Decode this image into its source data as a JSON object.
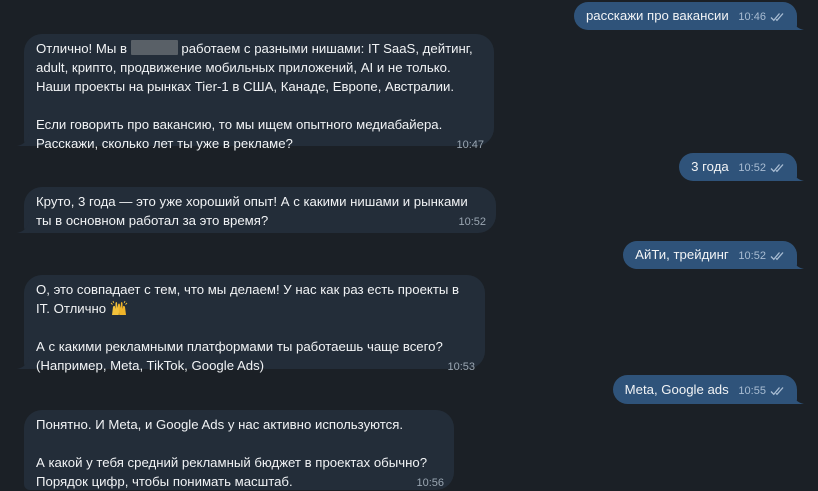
{
  "messages": {
    "m1": {
      "text": "расскажи про вакансии",
      "time": "10:46",
      "read": true
    },
    "m2": {
      "line1_before": "Отлично! Мы в",
      "line1_after": "работаем с разными нишами: IT SaaS, дейтинг,",
      "line2": "adult, крипто, продвижение мобильных приложений, AI и не только.",
      "line3": "Наши проекты на рынках Tier-1 в США, Канаде, Европе, Австралии.",
      "line4": "Если говорить про вакансию, то мы ищем опытного медиабайера.",
      "line5": "Расскажи, сколько лет ты уже в рекламе?",
      "time": "10:47"
    },
    "m3": {
      "text": "3 года",
      "time": "10:52",
      "read": true
    },
    "m4": {
      "line1": "Круто, 3 года — это уже хороший опыт! А с какими нишами и рынками",
      "line2": "ты в основном работал за это время?",
      "time": "10:52"
    },
    "m5": {
      "text": "АйТи, трейдинг",
      "time": "10:52",
      "read": true
    },
    "m6": {
      "line1": "О, это совпадает с тем, что мы делаем! У нас как раз есть проекты в",
      "line2": "IT. Отлично",
      "line3": "А с какими рекламными платформами ты работаешь чаще всего?",
      "line4": "(Например, Meta, TikTok, Google Ads)",
      "time": "10:53"
    },
    "m7": {
      "text": "Meta, Google ads",
      "time": "10:55",
      "read": true
    },
    "m8": {
      "line1": "Понятно. И Meta, и Google Ads у нас активно используются.",
      "line2": "А какой у тебя средний рекламный бюджет в проектах обычно?",
      "line3": "Порядок цифр, чтобы понимать масштаб.",
      "time": "10:56"
    }
  },
  "icons": {
    "read_receipt": "double-check-icon",
    "raised_hands": "raised-hands-emoji"
  },
  "colors": {
    "background": "#1b2026",
    "incoming_bubble": "#232d39",
    "outgoing_bubble": "#2f537a"
  }
}
